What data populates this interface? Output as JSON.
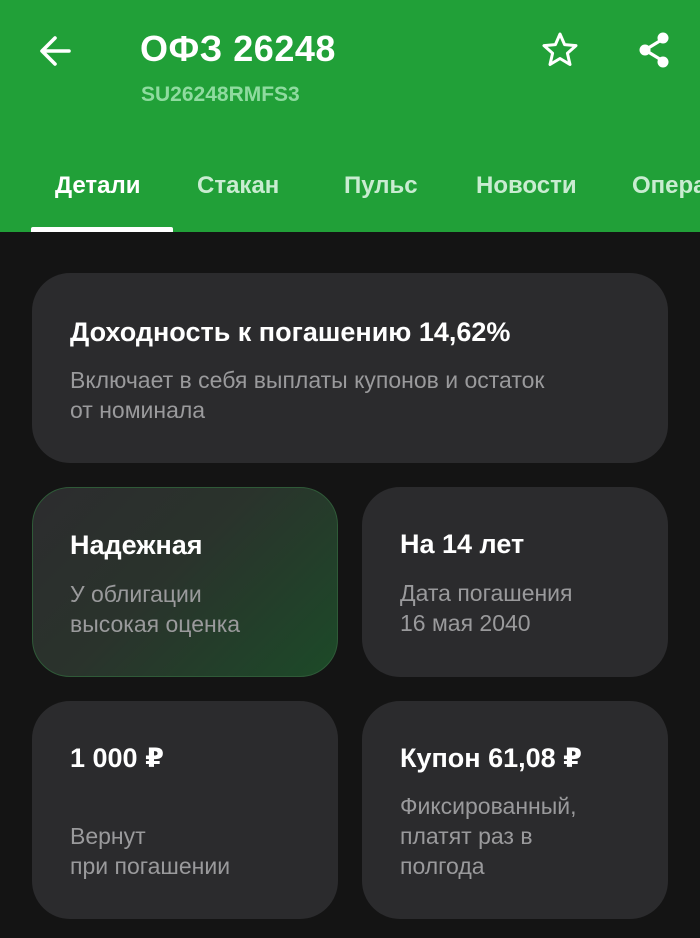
{
  "header": {
    "title": "ОФЗ 26248",
    "subtitle": "SU26248RMFS3",
    "background_color": "#21a038",
    "back_icon": "arrow-left-icon",
    "favorite_icon": "star-outline-icon",
    "share_icon": "share-icon"
  },
  "tabs": [
    {
      "label": "Детали",
      "active": true
    },
    {
      "label": "Стакан",
      "active": false
    },
    {
      "label": "Пульс",
      "active": false
    },
    {
      "label": "Новости",
      "active": false
    },
    {
      "label": "Опера",
      "active": false
    }
  ],
  "cards": {
    "yield": {
      "title": "Доходность к погашению 14,62%",
      "desc_line1": "Включает в себя выплаты купонов и остаток",
      "desc_line2": "от номинала"
    },
    "reliability": {
      "title": "Надежная",
      "desc_line1": "У облигации",
      "desc_line2": "высокая оценка"
    },
    "term": {
      "title": "На 14 лет",
      "desc_line1": "Дата погашения",
      "desc_line2": "16 мая 2040"
    },
    "nominal": {
      "title": "1 000 ₽",
      "desc_line1": "Вернут",
      "desc_line2": "при погашении"
    },
    "coupon": {
      "title": "Купон 61,08 ₽",
      "desc_line1": "Фиксированный,",
      "desc_line2": "платят раз в",
      "desc_line3": "полгода"
    }
  }
}
